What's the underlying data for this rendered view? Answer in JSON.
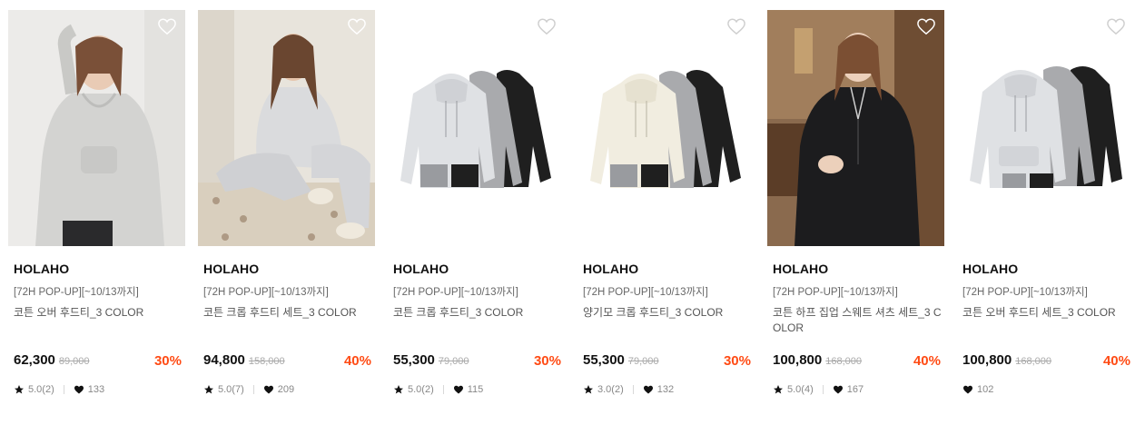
{
  "products": [
    {
      "brand": "HOLAHO",
      "promo": "[72H POP-UP][~10/13까지]",
      "name": "코튼 오버 후드티_3 COLOR",
      "price": "62,300",
      "original_price": "89,000",
      "discount": "30%",
      "rating": "5.0(2)",
      "likes": "133"
    },
    {
      "brand": "HOLAHO",
      "promo": "[72H POP-UP][~10/13까지]",
      "name": "코튼 크롭 후드티 세트_3 COLOR",
      "price": "94,800",
      "original_price": "158,000",
      "discount": "40%",
      "rating": "5.0(7)",
      "likes": "209"
    },
    {
      "brand": "HOLAHO",
      "promo": "[72H POP-UP][~10/13까지]",
      "name": "코튼 크롭 후드티_3 COLOR",
      "price": "55,300",
      "original_price": "79,000",
      "discount": "30%",
      "rating": "5.0(2)",
      "likes": "115"
    },
    {
      "brand": "HOLAHO",
      "promo": "[72H POP-UP][~10/13까지]",
      "name": "양기모 크롭 후드티_3 COLOR",
      "price": "55,300",
      "original_price": "79,000",
      "discount": "30%",
      "rating": "3.0(2)",
      "likes": "132"
    },
    {
      "brand": "HOLAHO",
      "promo": "[72H POP-UP][~10/13까지]",
      "name": "코튼 하프 집업 스웨트 셔츠 세트_3 COLOR",
      "price": "100,800",
      "original_price": "168,000",
      "discount": "40%",
      "rating": "5.0(4)",
      "likes": "167"
    },
    {
      "brand": "HOLAHO",
      "promo": "[72H POP-UP][~10/13까지]",
      "name": "코튼 오버 후드티 세트_3 COLOR",
      "price": "100,800",
      "original_price": "168,000",
      "discount": "40%",
      "likes": "102"
    }
  ],
  "icons": {
    "wishlist": "heart-outline-icon",
    "rating": "star-icon",
    "likes": "heart-filled-icon"
  },
  "colors": {
    "discount": "#ff4b14",
    "text": "#111111",
    "muted": "#888888"
  }
}
